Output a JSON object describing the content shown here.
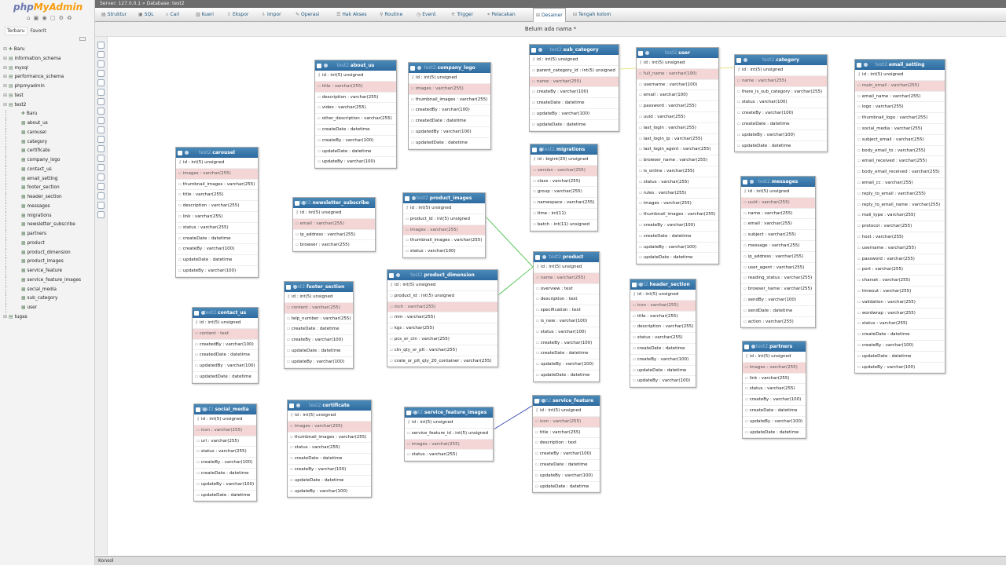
{
  "app": {
    "logo_php": "php",
    "logo_my": "MyAdmin",
    "icons": "⌂ ▣ ◉ ▢ ⚙ ♻"
  },
  "topbar": {
    "path": "Server: 127.0.0.1 » Database: test2"
  },
  "page_title": "Belum ada nama *",
  "nav": {
    "recent": "Terbaru",
    "favorites": "Favorit",
    "databases": [
      {
        "label": "Baru",
        "icon": "new-icon",
        "sub": false
      },
      {
        "label": "information_schema",
        "icon": "db-icon",
        "sub": false
      },
      {
        "label": "mysql",
        "icon": "db-icon",
        "sub": false
      },
      {
        "label": "performance_schema",
        "icon": "db-icon",
        "sub": false
      },
      {
        "label": "phpmyadmin",
        "icon": "db-icon",
        "sub": false
      },
      {
        "label": "test",
        "icon": "db-icon",
        "sub": false
      },
      {
        "label": "test2",
        "icon": "db-icon",
        "sub": false
      },
      {
        "label": "Baru",
        "icon": "new-icon",
        "sub": true
      },
      {
        "label": "about_us",
        "icon": "table-icon",
        "sub": true
      },
      {
        "label": "carousel",
        "icon": "table-icon",
        "sub": true
      },
      {
        "label": "category",
        "icon": "table-icon",
        "sub": true
      },
      {
        "label": "certificate",
        "icon": "table-icon",
        "sub": true
      },
      {
        "label": "company_logo",
        "icon": "table-icon",
        "sub": true
      },
      {
        "label": "contact_us",
        "icon": "table-icon",
        "sub": true
      },
      {
        "label": "email_setting",
        "icon": "table-icon",
        "sub": true
      },
      {
        "label": "footer_section",
        "icon": "table-icon",
        "sub": true
      },
      {
        "label": "header_section",
        "icon": "table-icon",
        "sub": true
      },
      {
        "label": "messages",
        "icon": "table-icon",
        "sub": true
      },
      {
        "label": "migrations",
        "icon": "table-icon",
        "sub": true
      },
      {
        "label": "newsletter_subscribe",
        "icon": "table-icon",
        "sub": true
      },
      {
        "label": "partners",
        "icon": "table-icon",
        "sub": true
      },
      {
        "label": "product",
        "icon": "table-icon",
        "sub": true
      },
      {
        "label": "product_dimension",
        "icon": "table-icon",
        "sub": true
      },
      {
        "label": "product_images",
        "icon": "table-icon",
        "sub": true
      },
      {
        "label": "service_feature",
        "icon": "table-icon",
        "sub": true
      },
      {
        "label": "service_feature_images",
        "icon": "table-icon",
        "sub": true
      },
      {
        "label": "social_media",
        "icon": "table-icon",
        "sub": true
      },
      {
        "label": "sub_category",
        "icon": "table-icon",
        "sub": true
      },
      {
        "label": "user",
        "icon": "table-icon",
        "sub": true
      },
      {
        "label": "tugas",
        "icon": "db-icon",
        "sub": false
      }
    ]
  },
  "tabs": [
    {
      "label": "Struktur",
      "icon": "structure-icon"
    },
    {
      "label": "SQL",
      "icon": "sql-icon"
    },
    {
      "label": "Cari",
      "icon": "search-icon"
    },
    {
      "label": "Kueri",
      "icon": "query-icon"
    },
    {
      "label": "Ekspor",
      "icon": "export-icon"
    },
    {
      "label": "Impor",
      "icon": "import-icon"
    },
    {
      "label": "Operasi",
      "icon": "operations-icon"
    },
    {
      "label": "Hak Akses",
      "icon": "privileges-icon"
    },
    {
      "label": "Routine",
      "icon": "routines-icon"
    },
    {
      "label": "Event",
      "icon": "events-icon"
    },
    {
      "label": "Trigger",
      "icon": "triggers-icon"
    },
    {
      "label": "Pelacakan",
      "icon": "tracking-icon"
    },
    {
      "label": "Desainer",
      "icon": "designer-icon"
    },
    {
      "label": "Tengah kolom",
      "icon": "central-columns-icon"
    }
  ],
  "console": {
    "label": "Konsol"
  },
  "tables": [
    {
      "db": "test2",
      "name": "about_us",
      "cols": [
        "id : int(5) unsigned",
        "title : varchar(255)",
        "description : varchar(255)",
        "video : varchar(255)",
        "other_description : varchar(255)",
        "createDate : datetime",
        "createBy : varchar(100)",
        "updateDate : datetime",
        "updateBy : varchar(100)"
      ]
    },
    {
      "db": "test2",
      "name": "company_logo",
      "cols": [
        "id : int(5) unsigned",
        "images : varchar(255)",
        "thumbnail_images : varchar(255)",
        "createdBy : varchar(100)",
        "createdDate : datetime",
        "updatedBy : varchar(100)",
        "updatedDate : datetime"
      ]
    },
    {
      "db": "test2",
      "name": "sub_category",
      "cols": [
        "id : int(5) unsigned",
        "parent_category_id : int(5) unsigned",
        "name : varchar(255)",
        "createBy : varchar(100)",
        "createDate : datetime",
        "updateBy : varchar(100)",
        "updateDate : datetime"
      ]
    },
    {
      "db": "test2",
      "name": "user",
      "cols": [
        "id : int(5) unsigned",
        "full_name : varchar(100)",
        "username : varchar(100)",
        "email : varchar(100)",
        "password : varchar(255)",
        "uuid : varchar(255)",
        "last_login : varchar(255)",
        "last_login_ip : varchar(255)",
        "last_login_agent : varchar(255)",
        "browser_name : varchar(255)",
        "is_online : varchar(255)",
        "status : varchar(255)",
        "rules : varchar(255)",
        "images : varchar(255)",
        "thumbnail_images : varchar(255)",
        "createBy : varchar(100)",
        "createDate : datetime",
        "updateBy : varchar(100)",
        "updateDate : datetime"
      ]
    },
    {
      "db": "test2",
      "name": "category",
      "cols": [
        "id : int(5) unsigned",
        "name : varchar(255)",
        "there_is_sub_category : varchar(255)",
        "status : varchar(100)",
        "createBy : varchar(100)",
        "createDate : datetime",
        "updateBy : varchar(100)",
        "updateDate : datetime"
      ]
    },
    {
      "db": "test2",
      "name": "email_setting",
      "cols": [
        "id : int(5) unsigned",
        "main_email : varchar(255)",
        "email_name : varchar(255)",
        "logo : varchar(255)",
        "thumbnail_logo : varchar(255)",
        "social_media : varchar(255)",
        "subject_email : varchar(255)",
        "body_email_to : varchar(255)",
        "email_received : varchar(255)",
        "body_email_received : varchar(255)",
        "email_cc : varchar(255)",
        "reply_to_email : varchar(255)",
        "reply_to_email_name : varchar(255)",
        "mail_type : varchar(255)",
        "protocol : varchar(255)",
        "host : varchar(255)",
        "username : varchar(255)",
        "password : varchar(255)",
        "port : varchar(255)",
        "charset : varchar(255)",
        "timeout : varchar(255)",
        "validation : varchar(255)",
        "wordwrap : varchar(255)",
        "status : varchar(255)",
        "createDate : datetime",
        "createBy : varchar(100)",
        "updateDate : datetime",
        "updateBy : varchar(100)"
      ]
    },
    {
      "db": "test2",
      "name": "carousel",
      "cols": [
        "id : int(5) unsigned",
        "images : varchar(255)",
        "thumbnail_images : varchar(255)",
        "title : varchar(255)",
        "description : varchar(255)",
        "link : varchar(255)",
        "status : varchar(255)",
        "createDate : datetime",
        "createBy : varchar(100)",
        "updateDate : datetime",
        "updateBy : varchar(100)"
      ]
    },
    {
      "db": "test2",
      "name": "migrations",
      "cols": [
        "id : bigint(20) unsigned",
        "version : varchar(255)",
        "class : varchar(255)",
        "group : varchar(255)",
        "namespace : varchar(255)",
        "time : int(11)",
        "batch : int(11) unsigned"
      ]
    },
    {
      "db": "test2",
      "name": "newsletter_subscribe",
      "cols": [
        "id : int(5) unsigned",
        "email : varchar(255)",
        "ip_address : varchar(255)",
        "browser : varchar(255)"
      ]
    },
    {
      "db": "test2",
      "name": "product_images",
      "cols": [
        "id : int(5) unsigned",
        "product_id : int(5) unsigned",
        "images : varchar(255)",
        "thumbnail_images : varchar(255)",
        "status : varchar(100)"
      ]
    },
    {
      "db": "test2",
      "name": "messages",
      "cols": [
        "id : int(5) unsigned",
        "uuid : varchar(255)",
        "name : varchar(255)",
        "email : varchar(255)",
        "subject : varchar(255)",
        "message : varchar(255)",
        "ip_address : varchar(255)",
        "user_agent : varchar(255)",
        "reading_status : varchar(255)",
        "browser_name : varchar(255)",
        "sendBy : varchar(100)",
        "sendDate : datetime",
        "action : varchar(255)"
      ]
    },
    {
      "db": "test2",
      "name": "product",
      "cols": [
        "id : int(5) unsigned",
        "name : varchar(255)",
        "overview : text",
        "description : text",
        "specification : text",
        "is_new : varchar(100)",
        "status : varchar(100)",
        "createBy : varchar(100)",
        "createDate : datetime",
        "updateBy : varchar(100)",
        "updateDate : datetime"
      ]
    },
    {
      "db": "test2",
      "name": "product_dimension",
      "cols": [
        "id : int(5) unsigned",
        "product_id : int(5) unsigned",
        "inch : varchar(255)",
        "mm : varchar(255)",
        "kgs : varchar(255)",
        "pcs_or_ctn : varchar(255)",
        "ctn_qty_or_plt : varchar(255)",
        "crate_or_plt_qty_20_container : varchar(255)"
      ]
    },
    {
      "db": "test2",
      "name": "footer_section",
      "cols": [
        "id : int(5) unsigned",
        "content : varchar(255)",
        "telp_number : varchar(255)",
        "createDate : datetime",
        "createBy : varchar(100)",
        "updateDate : datetime",
        "updateBy : varchar(100)"
      ]
    },
    {
      "db": "test2",
      "name": "header_section",
      "cols": [
        "id : int(5) unsigned",
        "icon : varchar(255)",
        "title : varchar(255)",
        "description : varchar(255)",
        "status : varchar(255)",
        "createDate : datetime",
        "createBy : varchar(100)",
        "updateDate : datetime",
        "updateBy : varchar(100)"
      ]
    },
    {
      "db": "test2",
      "name": "contact_us",
      "cols": [
        "id : int(5) unsigned",
        "content : text",
        "createdBy : varchar(100)",
        "createdDate : datetime",
        "updatedBy : varchar(100)",
        "updatedDate : datetime"
      ]
    },
    {
      "db": "test2",
      "name": "partners",
      "cols": [
        "id : int(5) unsigned",
        "images : varchar(255)",
        "link : varchar(255)",
        "status : varchar(255)",
        "createBy : varchar(100)",
        "createDate : datetime",
        "updateBy : varchar(100)",
        "updateDate : datetime"
      ]
    },
    {
      "db": "test2",
      "name": "social_media",
      "cols": [
        "id : int(5) unsigned",
        "icon : varchar(255)",
        "url : varchar(255)",
        "status : varchar(255)",
        "createBy : varchar(100)",
        "createDate : datetime",
        "updateBy : varchar(100)",
        "updateDate : datetime"
      ]
    },
    {
      "db": "test2",
      "name": "certificate",
      "cols": [
        "id : int(5) unsigned",
        "images : varchar(255)",
        "thumbnail_images : varchar(255)",
        "status : varchar(255)",
        "createDate : datetime",
        "createBy : varchar(100)",
        "updateDate : datetime",
        "updateBy : varchar(100)"
      ]
    },
    {
      "db": "test2",
      "name": "service_feature_images",
      "cols": [
        "id : int(5) unsigned",
        "service_feature_id : int(5) unsigned",
        "images : varchar(255)",
        "status : varchar(255)"
      ]
    },
    {
      "db": "test2",
      "name": "service_feature",
      "cols": [
        "id : int(5) unsigned",
        "icon : varchar(255)",
        "title : varchar(255)",
        "description : text",
        "createBy : varchar(100)",
        "createDate : datetime",
        "updateBy : varchar(100)",
        "updateDate : datetime"
      ]
    }
  ],
  "colors": {
    "header": "#2e6aa0",
    "highlight": "#f4d6d6",
    "link_green": "#33bb33",
    "link_blue": "#2233aa",
    "link_yellow": "#dddd55"
  }
}
